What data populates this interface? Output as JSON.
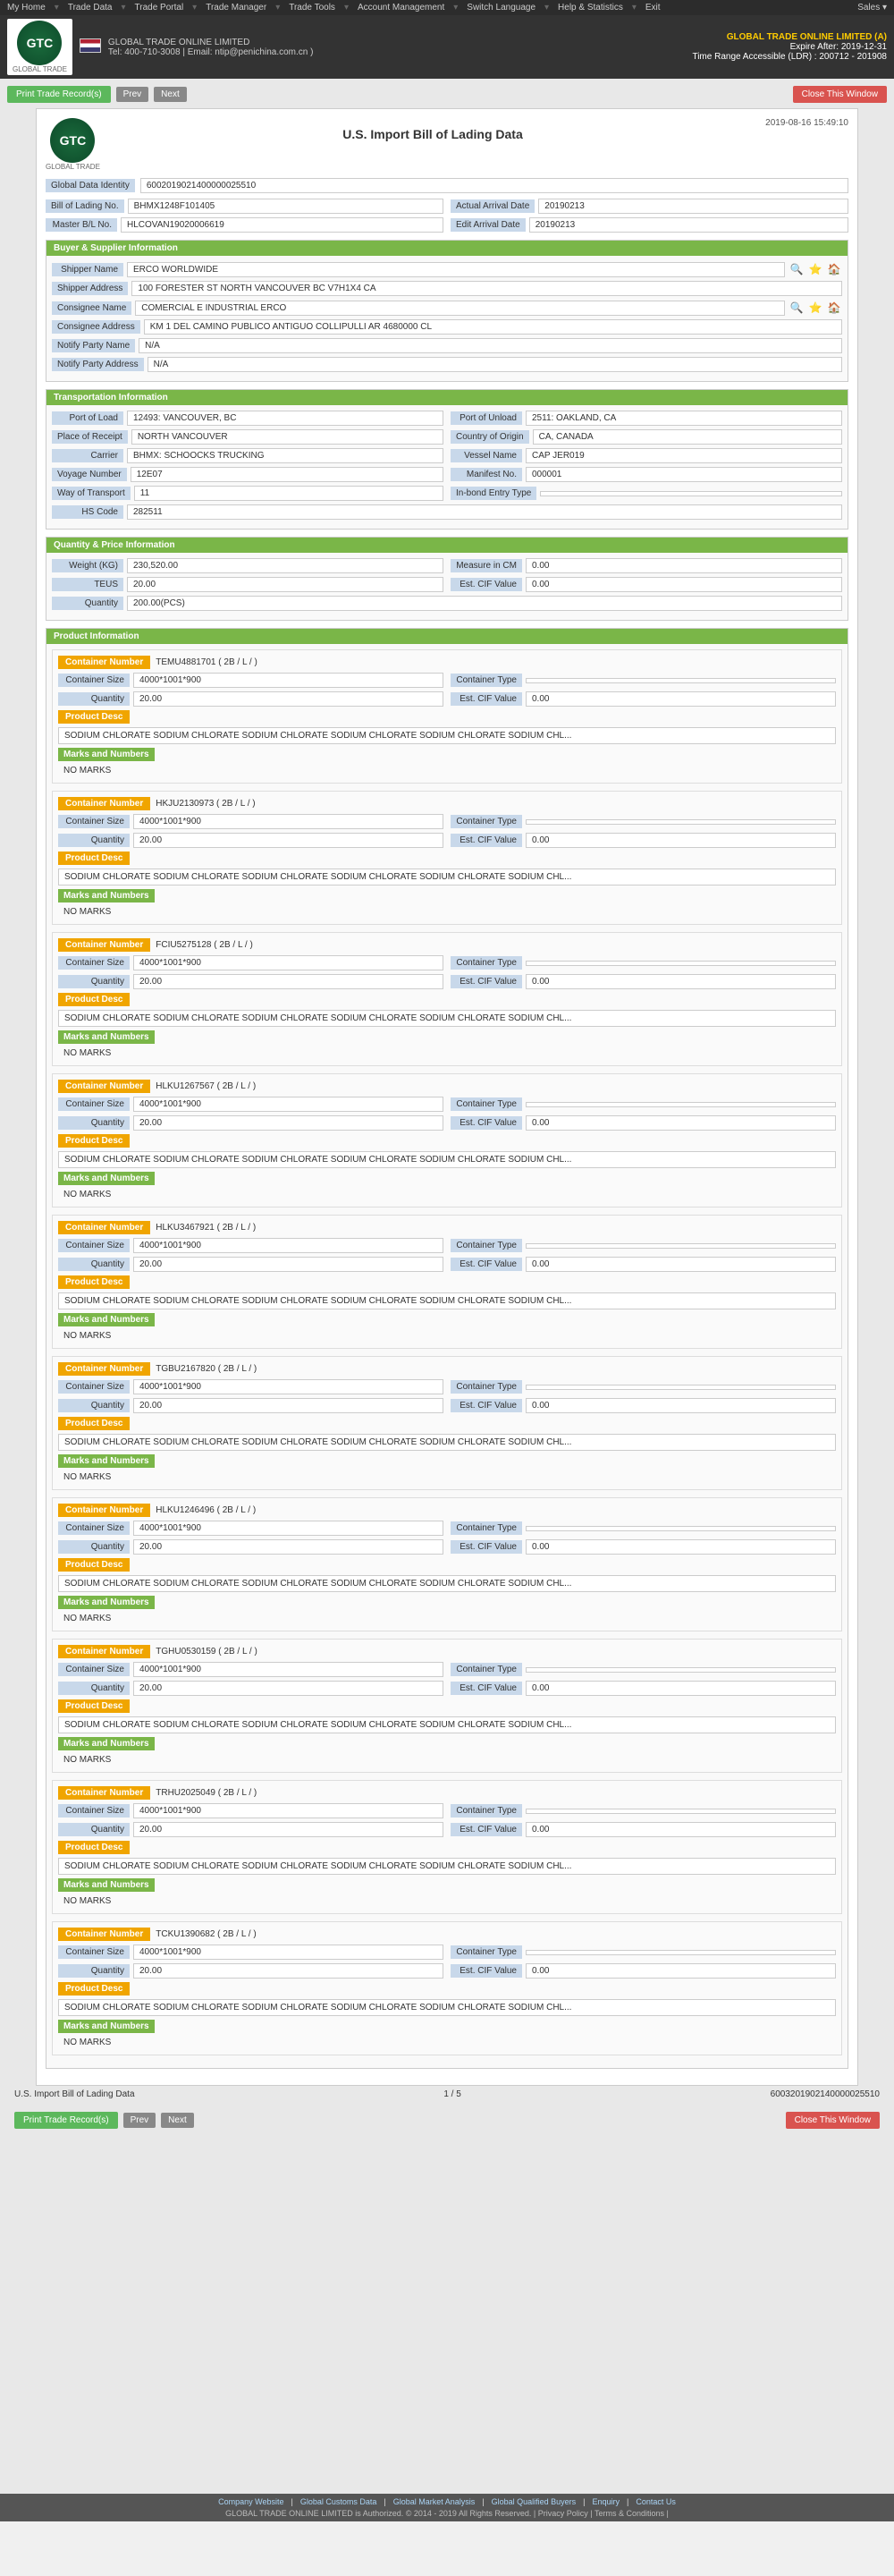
{
  "topNav": {
    "items": [
      "My Home",
      "Trade Data",
      "Trade Portal",
      "Trade Manager",
      "Trade Tools",
      "Account Management",
      "Switch Language",
      "Help & Statistics",
      "Exit"
    ],
    "salesLabel": "Sales"
  },
  "header": {
    "logoText": "GTC",
    "companyFull": "GLOBAL TRADE ONLINE LIMITED (A)",
    "expireInfo": "Expire After: 2019-12-31",
    "timeRange": "Time Range Accessible (LDR) : 200712 - 201908",
    "phone": "Tel: 400-710-3008",
    "email": "Email: ntip@penichina.com.cn",
    "company": "GLOBAL TRADE ONLINE LIMITED"
  },
  "subNav": {
    "items": [
      "GLOBAL TRADE ONLINE LIMITED | Tel : 400-710-3008 | Email: ntip@penichina.com.cn ]"
    ]
  },
  "pageTitle": "U.S. Import Bill of Lading Data",
  "printRecords": "Print Trade Record(s)",
  "closeWindow": "Close This Window",
  "prevBtn": "Prev",
  "nextBtn": "Next",
  "pageDate": "2019-08-16 15:49:10",
  "globalDataIdentity": {
    "label": "Global Data Identity",
    "value": "6002019021400000025510"
  },
  "billOfLading": {
    "label": "Bill of Lading No.",
    "value": "BHMX1248F101405"
  },
  "actualArrival": {
    "label": "Actual Arrival Date",
    "value": "20190213"
  },
  "masterBol": {
    "label": "Master B/L No.",
    "value": "HLCOVAN19020006619"
  },
  "editArrival": {
    "label": "Edit Arrival Date",
    "value": "20190213"
  },
  "buyerSupplier": {
    "title": "Buyer & Supplier Information",
    "shipperLabel": "Shipper Name",
    "shipperValue": "ERCO WORLDWIDE",
    "shipperAddrLabel": "Shipper Address",
    "shipperAddrValue": "100 FORESTER ST NORTH VANCOUVER BC V7H1X4 CA",
    "consigneeLabel": "Consignee Name",
    "consigneeValue": "COMERCIAL E INDUSTRIAL ERCO",
    "consigneeAddrLabel": "Consignee Address",
    "consigneeAddrValue": "KM 1 DEL CAMINO PUBLICO ANTIGUO COLLIPULLI AR 4680000 CL",
    "notifyPartyLabel": "Notify Party Name",
    "notifyPartyValue": "N/A",
    "notifyPartyAddrLabel": "Notify Party Address",
    "notifyPartyAddrValue": "N/A"
  },
  "transportation": {
    "title": "Transportation Information",
    "portLoadLabel": "Port of Load",
    "portLoadValue": "12493: VANCOUVER, BC",
    "portUnloadLabel": "Port of Unload",
    "portUnloadValue": "2511: OAKLAND, CA",
    "placeReceiptLabel": "Place of Receipt",
    "placeReceiptValue": "NORTH VANCOUVER",
    "countryOriginLabel": "Country of Origin",
    "countryOriginValue": "CA, CANADA",
    "carrierLabel": "Carrier",
    "carrierValue": "BHMX: SCHOOCKS TRUCKING",
    "vesselLabel": "Vessel Name",
    "vesselValue": "CAP JER019",
    "voyageLabel": "Voyage Number",
    "voyageValue": "12E07",
    "manifestLabel": "Manifest No.",
    "manifestValue": "000001",
    "wayTransportLabel": "Way of Transport",
    "wayTransportValue": "11",
    "inbondLabel": "In-bond Entry Type",
    "inbondValue": "",
    "hsCodeLabel": "HS Code",
    "hsCodeValue": "282511"
  },
  "quantityPrice": {
    "title": "Quantity & Price Information",
    "weightLabel": "Weight (KG)",
    "weightValue": "230,520.00",
    "measureLabel": "Measure in CM",
    "measureValue": "0.00",
    "teusLabel": "TEUS",
    "teusValue": "20.00",
    "estCifLabel": "Est. CIF Value",
    "estCifValue": "0.00",
    "quantityLabel": "Quantity",
    "quantityValue": "200.00(PCS)"
  },
  "productInfo": {
    "title": "Product Information"
  },
  "containers": [
    {
      "id": 1,
      "numberLabel": "Container Number",
      "numberValue": "TEMU4881701 ( 2B / L / )",
      "sizeLabel": "Container Size",
      "sizeValue": "4000*1001*900",
      "typeLabel": "Container Type",
      "typeValue": "",
      "quantityLabel": "Quantity",
      "quantityValue": "20.00",
      "estCifLabel": "Est. CIF Value",
      "estCifValue": "0.00",
      "productDescLabel": "Product Desc",
      "productDescValue": "SODIUM CHLORATE SODIUM CHLORATE SODIUM CHLORATE SODIUM CHLORATE SODIUM CHLORATE SODIUM CHL...",
      "marksLabel": "Marks and Numbers",
      "marksValue": "NO MARKS"
    },
    {
      "id": 2,
      "numberLabel": "Container Number",
      "numberValue": "HKJU2130973 ( 2B / L / )",
      "sizeLabel": "Container Size",
      "sizeValue": "4000*1001*900",
      "typeLabel": "Container Type",
      "typeValue": "",
      "quantityLabel": "Quantity",
      "quantityValue": "20.00",
      "estCifLabel": "Est. CIF Value",
      "estCifValue": "0.00",
      "productDescLabel": "Product Desc",
      "productDescValue": "SODIUM CHLORATE SODIUM CHLORATE SODIUM CHLORATE SODIUM CHLORATE SODIUM CHLORATE SODIUM CHL...",
      "marksLabel": "Marks and Numbers",
      "marksValue": "NO MARKS"
    },
    {
      "id": 3,
      "numberLabel": "Container Number",
      "numberValue": "FCIU5275128 ( 2B / L / )",
      "sizeLabel": "Container Size",
      "sizeValue": "4000*1001*900",
      "typeLabel": "Container Type",
      "typeValue": "",
      "quantityLabel": "Quantity",
      "quantityValue": "20.00",
      "estCifLabel": "Est. CIF Value",
      "estCifValue": "0.00",
      "productDescLabel": "Product Desc",
      "productDescValue": "SODIUM CHLORATE SODIUM CHLORATE SODIUM CHLORATE SODIUM CHLORATE SODIUM CHLORATE SODIUM CHL...",
      "marksLabel": "Marks and Numbers",
      "marksValue": "NO MARKS"
    },
    {
      "id": 4,
      "numberLabel": "Container Number",
      "numberValue": "HLKU1267567 ( 2B / L / )",
      "sizeLabel": "Container Size",
      "sizeValue": "4000*1001*900",
      "typeLabel": "Container Type",
      "typeValue": "",
      "quantityLabel": "Quantity",
      "quantityValue": "20.00",
      "estCifLabel": "Est. CIF Value",
      "estCifValue": "0.00",
      "productDescLabel": "Product Desc",
      "productDescValue": "SODIUM CHLORATE SODIUM CHLORATE SODIUM CHLORATE SODIUM CHLORATE SODIUM CHLORATE SODIUM CHL...",
      "marksLabel": "Marks and Numbers",
      "marksValue": "NO MARKS"
    },
    {
      "id": 5,
      "numberLabel": "Container Number",
      "numberValue": "HLKU3467921 ( 2B / L / )",
      "sizeLabel": "Container Size",
      "sizeValue": "4000*1001*900",
      "typeLabel": "Container Type",
      "typeValue": "",
      "quantityLabel": "Quantity",
      "quantityValue": "20.00",
      "estCifLabel": "Est. CIF Value",
      "estCifValue": "0.00",
      "productDescLabel": "Product Desc",
      "productDescValue": "SODIUM CHLORATE SODIUM CHLORATE SODIUM CHLORATE SODIUM CHLORATE SODIUM CHLORATE SODIUM CHL...",
      "marksLabel": "Marks and Numbers",
      "marksValue": "NO MARKS"
    },
    {
      "id": 6,
      "numberLabel": "Container Number",
      "numberValue": "TGBU2167820 ( 2B / L / )",
      "sizeLabel": "Container Size",
      "sizeValue": "4000*1001*900",
      "typeLabel": "Container Type",
      "typeValue": "",
      "quantityLabel": "Quantity",
      "quantityValue": "20.00",
      "estCifLabel": "Est. CIF Value",
      "estCifValue": "0.00",
      "productDescLabel": "Product Desc",
      "productDescValue": "SODIUM CHLORATE SODIUM CHLORATE SODIUM CHLORATE SODIUM CHLORATE SODIUM CHLORATE SODIUM CHL...",
      "marksLabel": "Marks and Numbers",
      "marksValue": "NO MARKS"
    },
    {
      "id": 7,
      "numberLabel": "Container Number",
      "numberValue": "HLKU1246496 ( 2B / L / )",
      "sizeLabel": "Container Size",
      "sizeValue": "4000*1001*900",
      "typeLabel": "Container Type",
      "typeValue": "",
      "quantityLabel": "Quantity",
      "quantityValue": "20.00",
      "estCifLabel": "Est. CIF Value",
      "estCifValue": "0.00",
      "productDescLabel": "Product Desc",
      "productDescValue": "SODIUM CHLORATE SODIUM CHLORATE SODIUM CHLORATE SODIUM CHLORATE SODIUM CHLORATE SODIUM CHL...",
      "marksLabel": "Marks and Numbers",
      "marksValue": "NO MARKS"
    },
    {
      "id": 8,
      "numberLabel": "Container Number",
      "numberValue": "TGHU0530159 ( 2B / L / )",
      "sizeLabel": "Container Size",
      "sizeValue": "4000*1001*900",
      "typeLabel": "Container Type",
      "typeValue": "",
      "quantityLabel": "Quantity",
      "quantityValue": "20.00",
      "estCifLabel": "Est. CIF Value",
      "estCifValue": "0.00",
      "productDescLabel": "Product Desc",
      "productDescValue": "SODIUM CHLORATE SODIUM CHLORATE SODIUM CHLORATE SODIUM CHLORATE SODIUM CHLORATE SODIUM CHL...",
      "marksLabel": "Marks and Numbers",
      "marksValue": "NO MARKS"
    },
    {
      "id": 9,
      "numberLabel": "Container Number",
      "numberValue": "TRHU2025049 ( 2B / L / )",
      "sizeLabel": "Container Size",
      "sizeValue": "4000*1001*900",
      "typeLabel": "Container Type",
      "typeValue": "",
      "quantityLabel": "Quantity",
      "quantityValue": "20.00",
      "estCifLabel": "Est. CIF Value",
      "estCifValue": "0.00",
      "productDescLabel": "Product Desc",
      "productDescValue": "SODIUM CHLORATE SODIUM CHLORATE SODIUM CHLORATE SODIUM CHLORATE SODIUM CHLORATE SODIUM CHL...",
      "marksLabel": "Marks and Numbers",
      "marksValue": "NO MARKS"
    },
    {
      "id": 10,
      "numberLabel": "Container Number",
      "numberValue": "TCKU1390682 ( 2B / L / )",
      "sizeLabel": "Container Size",
      "sizeValue": "4000*1001*900",
      "typeLabel": "Container Type",
      "typeValue": "",
      "quantityLabel": "Quantity",
      "quantityValue": "20.00",
      "estCifLabel": "Est. CIF Value",
      "estCifValue": "0.00",
      "productDescLabel": "Product Desc",
      "productDescValue": "SODIUM CHLORATE SODIUM CHLORATE SODIUM CHLORATE SODIUM CHLORATE SODIUM CHLORATE SODIUM CHL...",
      "marksLabel": "Marks and Numbers",
      "marksValue": "NO MARKS"
    }
  ],
  "bottomBar": {
    "title": "U.S. Import Bill of Lading Data",
    "pageIndicator": "1 / 5",
    "globalId": "6003201902140000025510"
  },
  "footer": {
    "links": [
      "Company Website",
      "Global Customs Data",
      "Global Market Analysis",
      "Global Qualified Buyers",
      "Enquiry",
      "Contact Us"
    ],
    "copyright": "GLOBAL TRADE ONLINE LIMITED is Authorized. © 2014 - 2019 All Rights Reserved. | Privacy Policy | Terms & Conditions |"
  }
}
